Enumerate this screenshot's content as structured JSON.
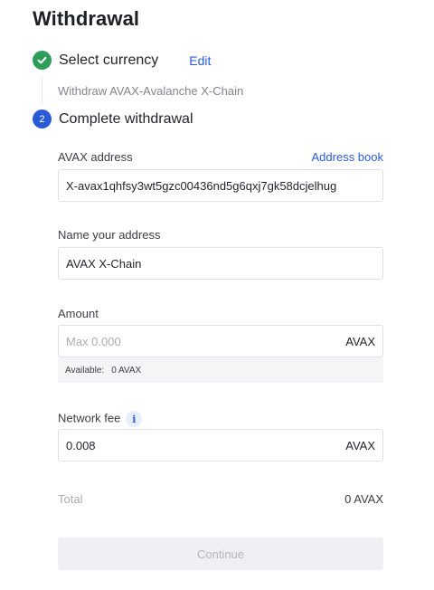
{
  "page": {
    "title": "Withdrawal"
  },
  "steps": {
    "step1": {
      "title": "Select currency",
      "edit_label": "Edit",
      "summary": "Withdraw AVAX-Avalanche X-Chain"
    },
    "step2": {
      "number": "2",
      "title": "Complete withdrawal"
    }
  },
  "form": {
    "address": {
      "label": "AVAX address",
      "address_book_label": "Address book",
      "value": "X-avax1qhfsy3wt5gzc00436nd5g6qxj7gk58dcjelhug"
    },
    "name": {
      "label": "Name your address",
      "value": "AVAX X-Chain"
    },
    "amount": {
      "label": "Amount",
      "placeholder": "Max 0.000",
      "unit": "AVAX",
      "available_label": "Available:",
      "available_value": "0 AVAX"
    },
    "network_fee": {
      "label": "Network fee",
      "info_glyph": "i",
      "value": "0.008",
      "unit": "AVAX"
    },
    "total": {
      "label": "Total",
      "value": "0 AVAX"
    },
    "continue_label": "Continue"
  },
  "colors": {
    "accent": "#2a5bd7",
    "success": "#2e9d5a",
    "disabled_bg": "#eef0f3",
    "disabled_text": "#b3b8be"
  }
}
